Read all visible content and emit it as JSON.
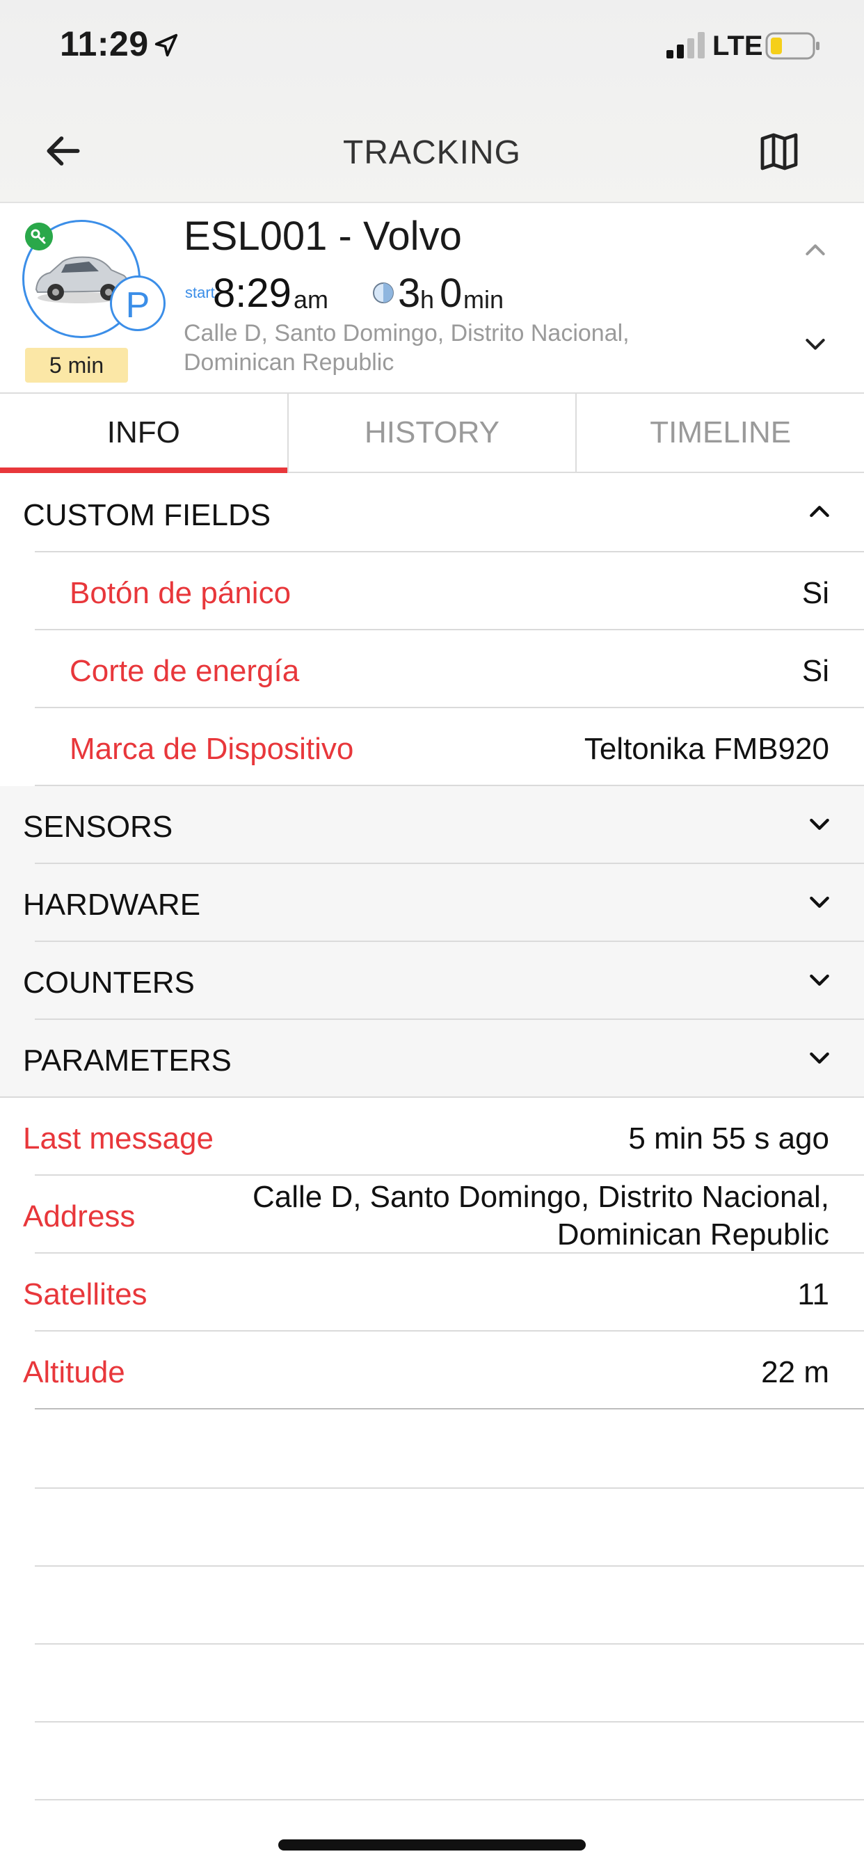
{
  "status": {
    "time": "11:29",
    "network": "LTE"
  },
  "nav": {
    "title": "TRACKING"
  },
  "object": {
    "name": "ESL001 - Volvo",
    "time_badge": "5 min",
    "park_letter": "P",
    "start_label": "start",
    "start_time": "8:29",
    "start_unit": "am",
    "duration_hours": "3",
    "duration_hours_unit": "h",
    "duration_minutes": "0",
    "duration_minutes_unit": "min",
    "address": "Calle D, Santo Domingo, Distrito Nacional, Dominican Republic"
  },
  "tabs": [
    {
      "label": "INFO",
      "active": true
    },
    {
      "label": "HISTORY",
      "active": false
    },
    {
      "label": "TIMELINE",
      "active": false
    }
  ],
  "custom_fields": {
    "title": "CUSTOM FIELDS",
    "items": [
      {
        "label": "Botón de pánico",
        "value": "Si"
      },
      {
        "label": "Corte de energía",
        "value": "Si"
      },
      {
        "label": "Marca de Dispositivo",
        "value": "Teltonika FMB920"
      }
    ]
  },
  "sections": [
    {
      "title": "SENSORS"
    },
    {
      "title": "HARDWARE"
    },
    {
      "title": "COUNTERS"
    },
    {
      "title": "PARAMETERS"
    }
  ],
  "info": [
    {
      "label": "Last message",
      "value": "5 min 55 s ago"
    },
    {
      "label": "Address",
      "value_line1": "Calle D, Santo Domingo, Distrito Nacional,",
      "value_line2": "Dominican Republic"
    },
    {
      "label": "Satellites",
      "value": "11"
    },
    {
      "label": "Altitude",
      "value": "22 m"
    }
  ],
  "colors": {
    "accent": "#e8373b",
    "blue": "#3b8ee8",
    "badge": "#fbe7a6",
    "online": "#2aa84a"
  },
  "icons": [
    "location-arrow-icon",
    "signal-icon",
    "battery-icon",
    "back-arrow-icon",
    "map-icon",
    "key-icon",
    "car-icon",
    "parking-icon",
    "duration-icon",
    "chevron-up-icon",
    "chevron-down-icon"
  ]
}
